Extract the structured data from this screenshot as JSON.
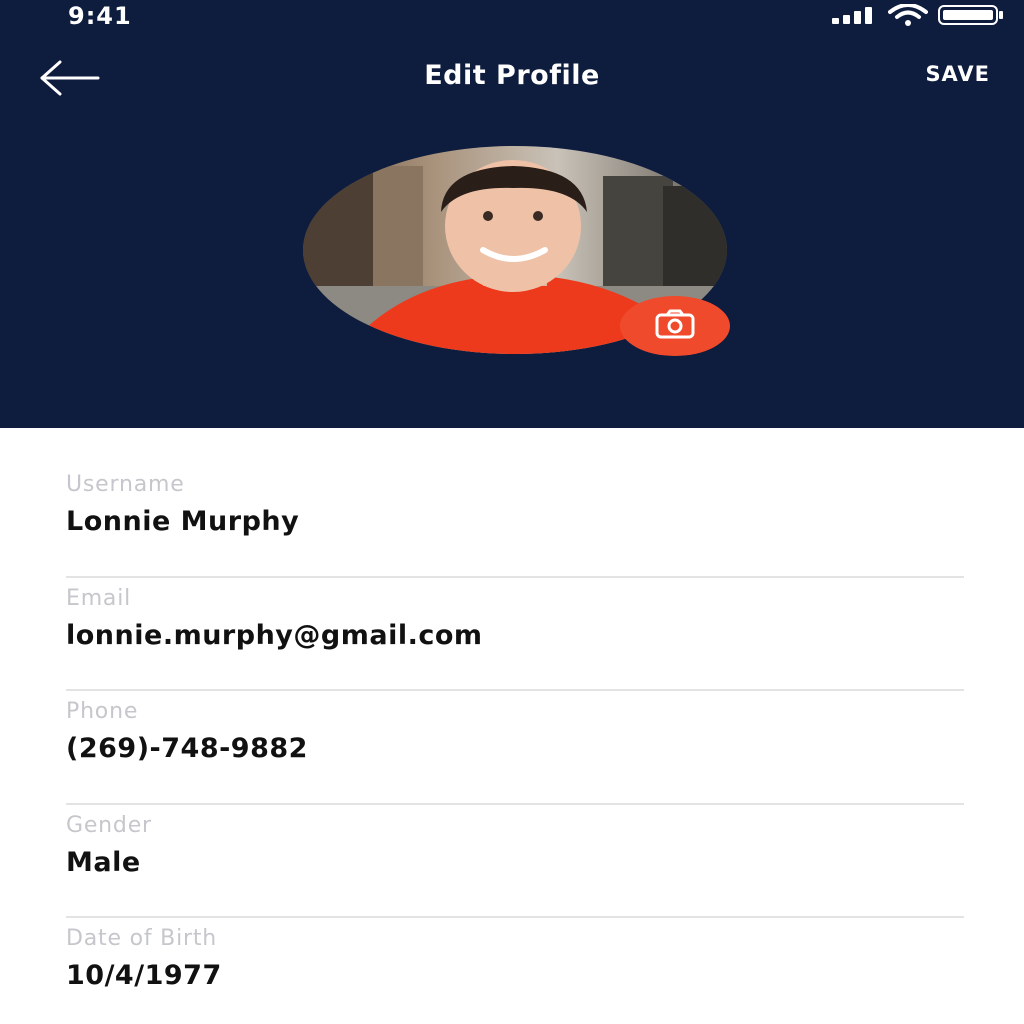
{
  "status_bar": {
    "time": "9:41"
  },
  "nav": {
    "title": "Edit Profile",
    "save_label": "SAVE"
  },
  "profile": {
    "avatar_icon": "profile-photo",
    "camera_icon": "camera-icon"
  },
  "fields": [
    {
      "label": "Username",
      "value": "Lonnie Murphy"
    },
    {
      "label": "Email",
      "value": "lonnie.murphy@gmail.com"
    },
    {
      "label": "Phone",
      "value": "(269)-748-9882"
    },
    {
      "label": "Gender",
      "value": "Male"
    },
    {
      "label": "Date of Birth",
      "value": "10/4/1977"
    }
  ],
  "colors": {
    "header_bg": "#0e1c3e",
    "accent": "#f04a2c",
    "label": "#c6c7cc",
    "divider": "#e3e3e3"
  }
}
